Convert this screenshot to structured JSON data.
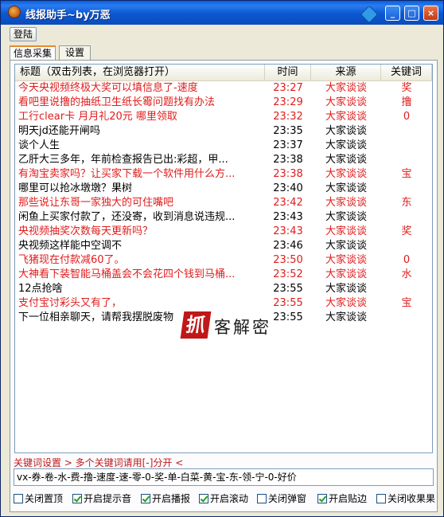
{
  "window": {
    "title": "线报助手~by万恶"
  },
  "toolbar": {
    "login_label": "登陆"
  },
  "tabs": [
    {
      "label": "信息采集",
      "active": true
    },
    {
      "label": "设置",
      "active": false
    }
  ],
  "table": {
    "headers": {
      "title": "标题（双击列表，在浏览器打开）",
      "time": "时间",
      "source": "来源",
      "keyword": "关键词"
    },
    "rows": [
      {
        "title": "今天央视频终极大奖可以填信息了-速度",
        "time": "23:27",
        "source": "大家谈谈",
        "keyword": "奖",
        "highlight": true
      },
      {
        "title": "看吧里说撸的抽纸卫生纸长霉问题找有办法",
        "time": "23:29",
        "source": "大家谈谈",
        "keyword": "撸",
        "highlight": true
      },
      {
        "title": "工行clear卡 月月礼20元 哪里领取",
        "time": "23:32",
        "source": "大家谈谈",
        "keyword": "0",
        "highlight": true
      },
      {
        "title": "明天jd还能开闸吗",
        "time": "23:35",
        "source": "大家谈谈",
        "keyword": "",
        "highlight": false
      },
      {
        "title": "谈个人生",
        "time": "23:37",
        "source": "大家谈谈",
        "keyword": "",
        "highlight": false
      },
      {
        "title": "乙肝大三多年，年前检查报告已出:彩超，甲...",
        "time": "23:38",
        "source": "大家谈谈",
        "keyword": "",
        "highlight": false
      },
      {
        "title": "有淘宝卖家吗？让买家下载一个软件用什么方...",
        "time": "23:38",
        "source": "大家谈谈",
        "keyword": "宝",
        "highlight": true
      },
      {
        "title": "哪里可以抢冰墩墩？果树",
        "time": "23:40",
        "source": "大家谈谈",
        "keyword": "",
        "highlight": false
      },
      {
        "title": "那些说让东哥一家独大的可住嘴吧",
        "time": "23:42",
        "source": "大家谈谈",
        "keyword": "东",
        "highlight": true
      },
      {
        "title": "闲鱼上买家付款了，还没寄，收到消息说违规...",
        "time": "23:43",
        "source": "大家谈谈",
        "keyword": "",
        "highlight": false
      },
      {
        "title": "央视频抽奖次数每天更新吗？",
        "time": "23:43",
        "source": "大家谈谈",
        "keyword": "奖",
        "highlight": true
      },
      {
        "title": "央视频这样能中空调不",
        "time": "23:46",
        "source": "大家谈谈",
        "keyword": "",
        "highlight": false
      },
      {
        "title": "飞猪现在付款减60了。",
        "time": "23:50",
        "source": "大家谈谈",
        "keyword": "0",
        "highlight": true
      },
      {
        "title": "大神看下装智能马桶盖会不会花四个钱到马桶...",
        "time": "23:52",
        "source": "大家谈谈",
        "keyword": "水",
        "highlight": true
      },
      {
        "title": "12点抢啥",
        "time": "23:55",
        "source": "大家谈谈",
        "keyword": "",
        "highlight": false
      },
      {
        "title": "支付宝讨彩头又有了，",
        "time": "23:55",
        "source": "大家谈谈",
        "keyword": "宝",
        "highlight": true
      },
      {
        "title": "下一位相亲聊天，请帮我摆脱废物",
        "time": "23:55",
        "source": "大家谈谈",
        "keyword": "",
        "highlight": false
      }
    ]
  },
  "watermark": {
    "glyph": "抓",
    "text": "客解密"
  },
  "keyword_settings": {
    "label": "关键词设置 > 多个关键词请用[-]分开 <",
    "value": "vx-券-卷-水-费-撸-速度-速-零-0-奖-单-白菜-黄-宝-东-领-宁-0-好价"
  },
  "options": [
    {
      "label": "关闭置顶",
      "checked": false
    },
    {
      "label": "开启提示音",
      "checked": true
    },
    {
      "label": "开启播报",
      "checked": true
    },
    {
      "label": "开启滚动",
      "checked": true
    },
    {
      "label": "关闭弹窗",
      "checked": false
    },
    {
      "label": "开启贴边",
      "checked": true
    },
    {
      "label": "关闭收果果",
      "checked": false
    }
  ],
  "colors": {
    "highlight": "#e01c1c",
    "normal": "#000000",
    "accent": "#e68b2c"
  }
}
